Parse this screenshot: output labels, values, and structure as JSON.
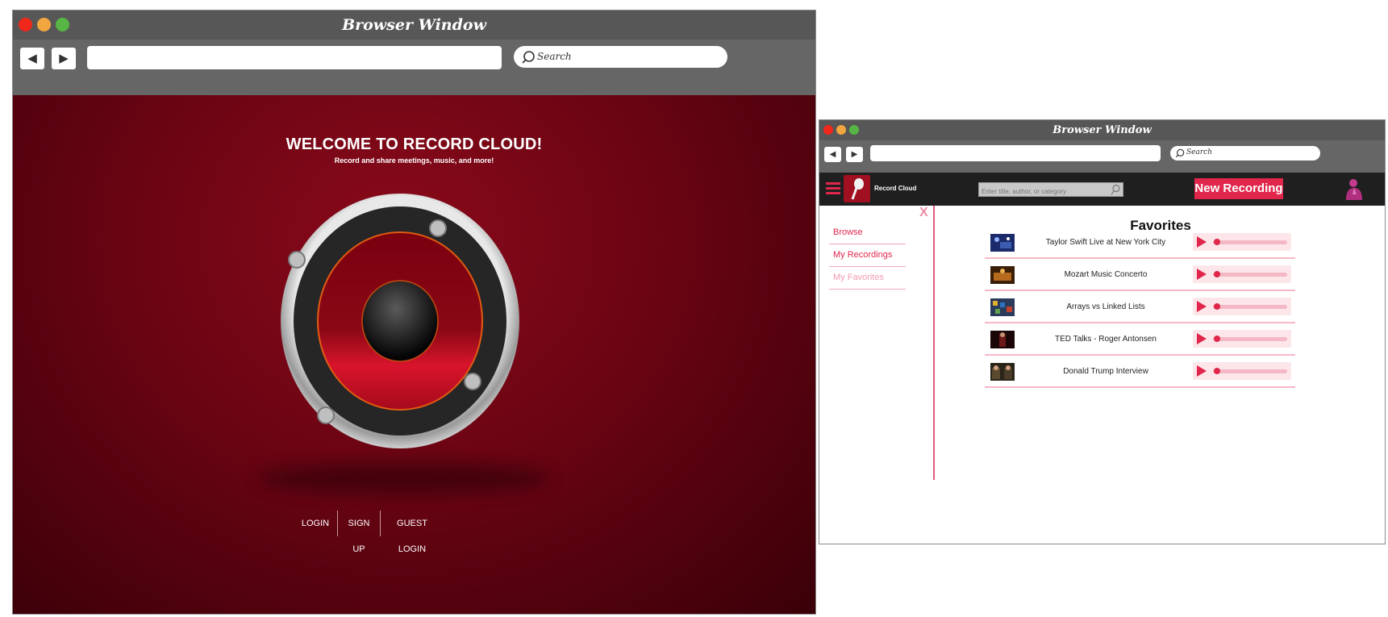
{
  "window_main": {
    "title": "Browser Window",
    "search_placeholder": "Search",
    "url": "",
    "welcome_title": "WELCOME TO RECORD CLOUD!",
    "welcome_subtitle": "Record and share meetings, music, and more!",
    "auth_links": [
      "LOGIN",
      "SIGN UP",
      "GUEST LOGIN"
    ]
  },
  "window_app": {
    "title": "Browser Window",
    "search_placeholder": "Search",
    "url": "",
    "brand": "Record Cloud",
    "app_search_placeholder": "Enter title, author, or category",
    "new_recording_label": "New Recording",
    "close_label": "X",
    "sidebar_items": [
      {
        "label": "Browse",
        "color": "#e0264a"
      },
      {
        "label": "My Recordings",
        "color": "#e0264a"
      },
      {
        "label": "My Favorites",
        "color": "#f29ab0"
      }
    ],
    "favorites_heading": "Favorites",
    "favorites": [
      {
        "title": "Taylor Swift Live at New York City",
        "progress": 0.0
      },
      {
        "title": "Mozart Music Concerto",
        "progress": 0.0
      },
      {
        "title": "Arrays vs Linked Lists",
        "progress": 0.0
      },
      {
        "title": "TED Talks - Roger Antonsen",
        "progress": 0.0
      },
      {
        "title": "Donald Trump Interview",
        "progress": 0.0
      }
    ]
  },
  "colors": {
    "accent": "#e0264a",
    "main_bg": "#6a0413",
    "chrome": "#575757"
  }
}
